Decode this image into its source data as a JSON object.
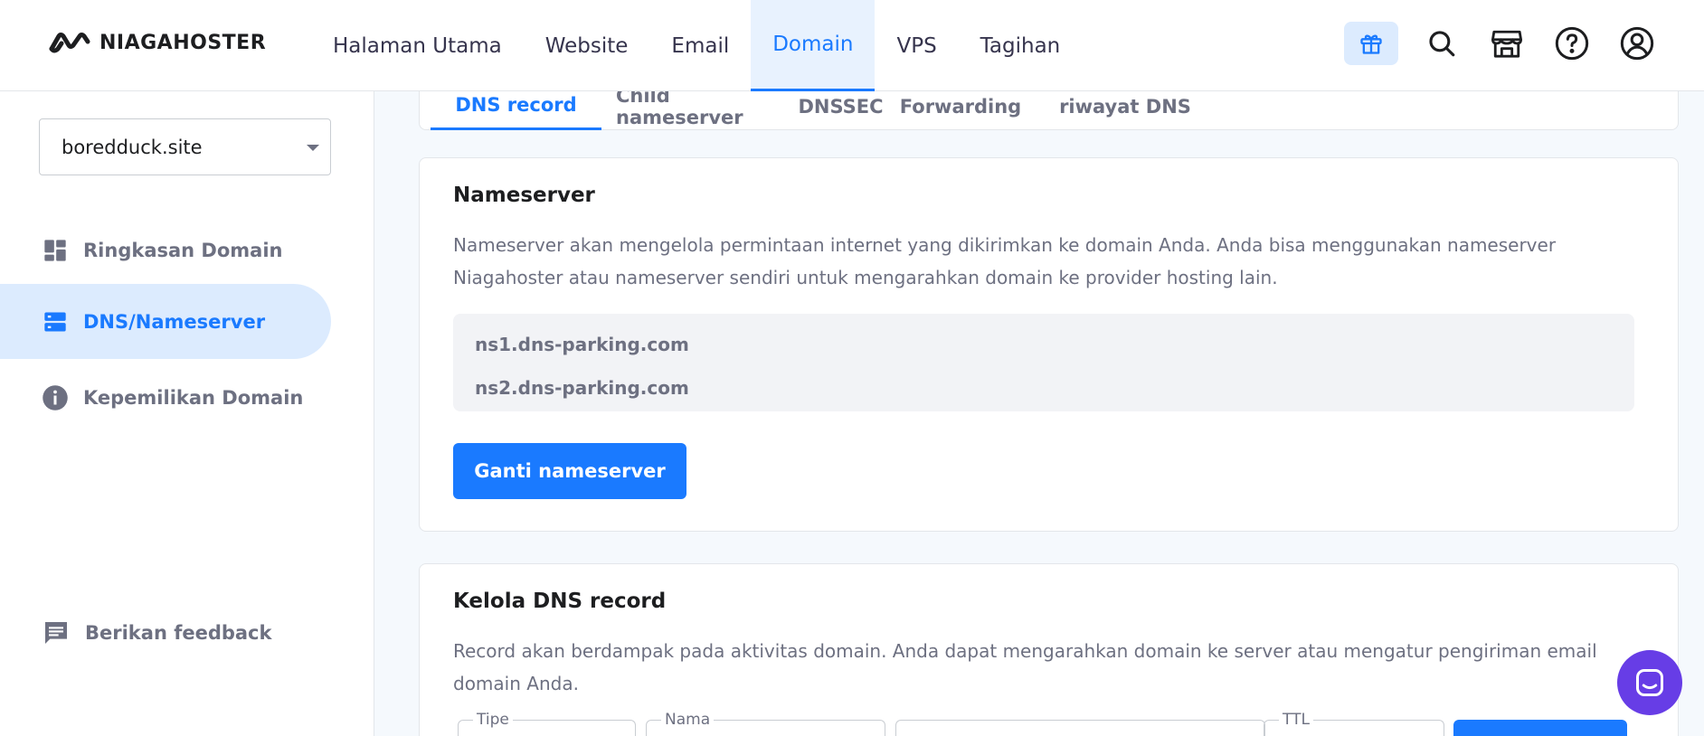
{
  "header": {
    "logo_text": "NIAGAHOSTER",
    "nav": [
      {
        "label": "Halaman Utama"
      },
      {
        "label": "Website"
      },
      {
        "label": "Email"
      },
      {
        "label": "Domain"
      },
      {
        "label": "VPS"
      },
      {
        "label": "Tagihan"
      }
    ],
    "active_nav": "Domain",
    "icons": [
      "gift-icon",
      "search-icon",
      "store-icon",
      "help-icon",
      "account-icon"
    ]
  },
  "sidebar": {
    "domain_select": "boredduck.site",
    "items": [
      {
        "label": "Ringkasan Domain",
        "icon": "dashboard-icon"
      },
      {
        "label": "DNS/Nameserver",
        "icon": "dns-icon"
      },
      {
        "label": "Kepemilikan Domain",
        "icon": "info-icon"
      }
    ],
    "active_item": "DNS/Nameserver",
    "feedback_label": "Berikan feedback"
  },
  "tabs": [
    {
      "label": "DNS record"
    },
    {
      "label": "Child nameserver"
    },
    {
      "label": "DNSSEC"
    },
    {
      "label": "Forwarding"
    },
    {
      "label": "riwayat DNS"
    }
  ],
  "active_tab": "DNS record",
  "nameserver_card": {
    "title": "Nameserver",
    "description": "Nameserver akan mengelola permintaan internet yang dikirimkan ke domain Anda. Anda bisa menggunakan nameserver Niagahoster atau nameserver sendiri untuk mengarahkan domain ke provider hosting lain.",
    "nameservers": [
      "ns1.dns-parking.com",
      "ns2.dns-parking.com"
    ],
    "button_label": "Ganti nameserver"
  },
  "dns_card": {
    "title": "Kelola DNS record",
    "description": "Record akan berdampak pada aktivitas domain. Anda dapat mengarahkan domain ke server atau mengatur pengiriman email domain Anda.",
    "fields": [
      {
        "label": "Tipe"
      },
      {
        "label": "Nama"
      },
      {
        "label": ""
      },
      {
        "label": "TTL"
      }
    ]
  },
  "colors": {
    "primary": "#1A7AFF",
    "active_bg": "#DCEBFE",
    "chat": "#673DE6",
    "muted_text": "#6D7081"
  }
}
